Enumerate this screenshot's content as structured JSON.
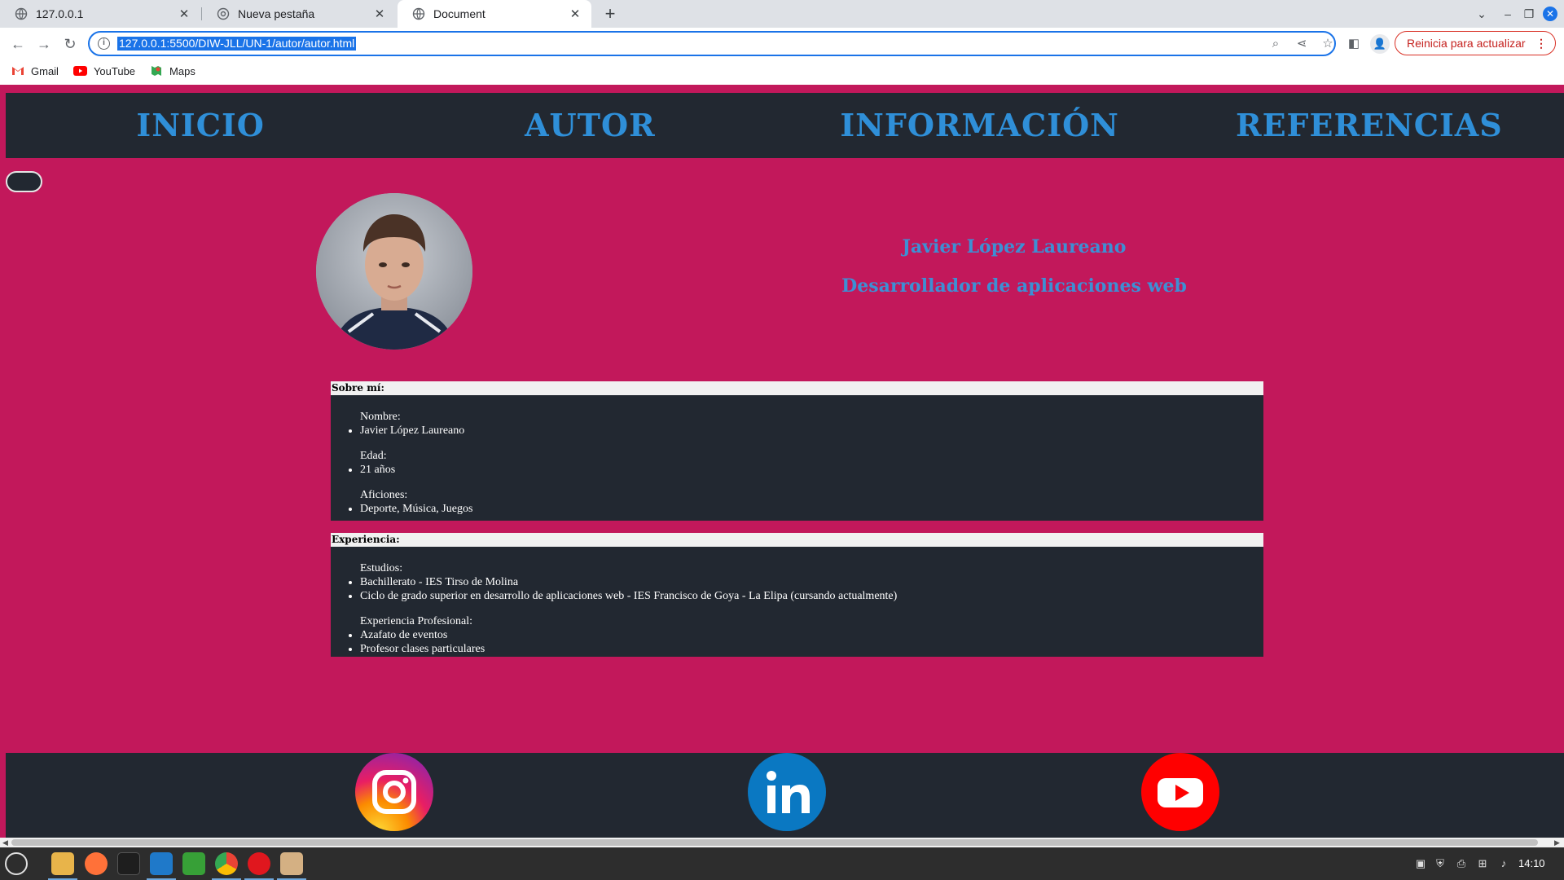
{
  "browser": {
    "tabs": [
      {
        "title": "127.0.0.1",
        "active": false
      },
      {
        "title": "Nueva pestaña",
        "active": false
      },
      {
        "title": "Document",
        "active": true
      }
    ],
    "url": "127.0.0.1:5500/DIW-JLL/UN-1/autor/autor.html",
    "update_button": "Reinicia para actualizar",
    "bookmarks": [
      "Gmail",
      "YouTube",
      "Maps"
    ]
  },
  "nav": {
    "items": [
      "INICIO",
      "AUTOR",
      "INFORMACIÓN",
      "REFERENCIAS"
    ]
  },
  "profile": {
    "name": "Javier López Laureano",
    "role": "Desarrollador de aplicaciones web"
  },
  "about": {
    "heading": "Sobre mí:",
    "groups": [
      {
        "title": "Nombre:",
        "items": [
          "Javier López Laureano"
        ]
      },
      {
        "title": "Edad:",
        "items": [
          "21 años"
        ]
      },
      {
        "title": "Aficiones:",
        "items": [
          "Deporte, Música, Juegos"
        ]
      }
    ]
  },
  "experience": {
    "heading": "Experiencia:",
    "groups": [
      {
        "title": "Estudios:",
        "items": [
          "Bachillerato - IES Tirso de Molina",
          "Ciclo de grado superior en desarrollo de aplicaciones web - IES Francisco de Goya - La Elipa (cursando actualmente)"
        ]
      },
      {
        "title": "Experiencia Profesional:",
        "items": [
          "Azafato de eventos",
          "Profesor clases particulares"
        ]
      }
    ]
  },
  "footer": {
    "icons": [
      "instagram-icon",
      "linkedin-icon",
      "youtube-icon"
    ]
  },
  "taskbar": {
    "clock": "14:10"
  },
  "colors": {
    "page_bg": "#c2185b",
    "panel_bg": "#222831",
    "accent": "#2f8fd8"
  }
}
